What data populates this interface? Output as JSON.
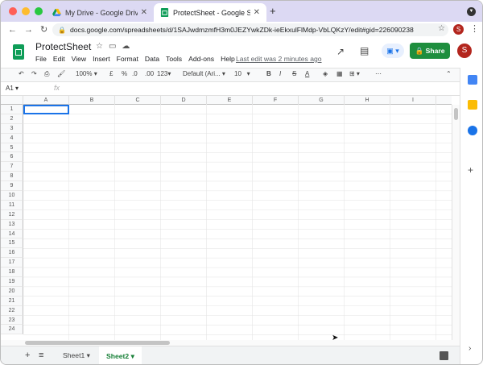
{
  "browser": {
    "tabs": [
      {
        "title": "My Drive - Google Drive",
        "icon": "google-drive-icon"
      },
      {
        "title": "ProtectSheet - Google Sheets",
        "icon": "google-sheets-icon"
      }
    ],
    "url": "docs.google.com/spreadsheets/d/1SAJwdmzmfH3m0JEZYwkZDk-ieEkxulFlMdp-VbLQKzY/edit#gid=226090238",
    "profile_initial": "S"
  },
  "app": {
    "title": "ProtectSheet",
    "menus": [
      "File",
      "Edit",
      "View",
      "Insert",
      "Format",
      "Data",
      "Tools",
      "Add-ons",
      "Help"
    ],
    "last_edit": "Last edit was 2 minutes ago",
    "share_label": "Share",
    "profile_initial": "S"
  },
  "toolbar": {
    "zoom": "100%",
    "currency": "£",
    "percent": "%",
    "dec_decrease": ".0",
    "dec_increase": ".00",
    "format": "123",
    "font": "Default (Ari...",
    "font_size": "10",
    "bold": "B",
    "italic": "I",
    "strike": "S",
    "text_color": "A"
  },
  "formula_bar": {
    "name_box": "A1",
    "fx": "fx"
  },
  "grid": {
    "columns": [
      "A",
      "B",
      "C",
      "D",
      "E",
      "F",
      "G",
      "H",
      "I"
    ],
    "rows": [
      "1",
      "2",
      "3",
      "4",
      "5",
      "6",
      "7",
      "8",
      "9",
      "10",
      "11",
      "12",
      "13",
      "14",
      "15",
      "16",
      "17",
      "18",
      "19",
      "20",
      "21",
      "22",
      "23",
      "24"
    ],
    "selected_cell": "A1"
  },
  "sheets": [
    {
      "name": "Sheet1",
      "active": false
    },
    {
      "name": "Sheet2",
      "active": true
    }
  ],
  "colors": {
    "accent": "#1a73e8",
    "brand": "#0f9d58",
    "share": "#1e8e3e"
  }
}
